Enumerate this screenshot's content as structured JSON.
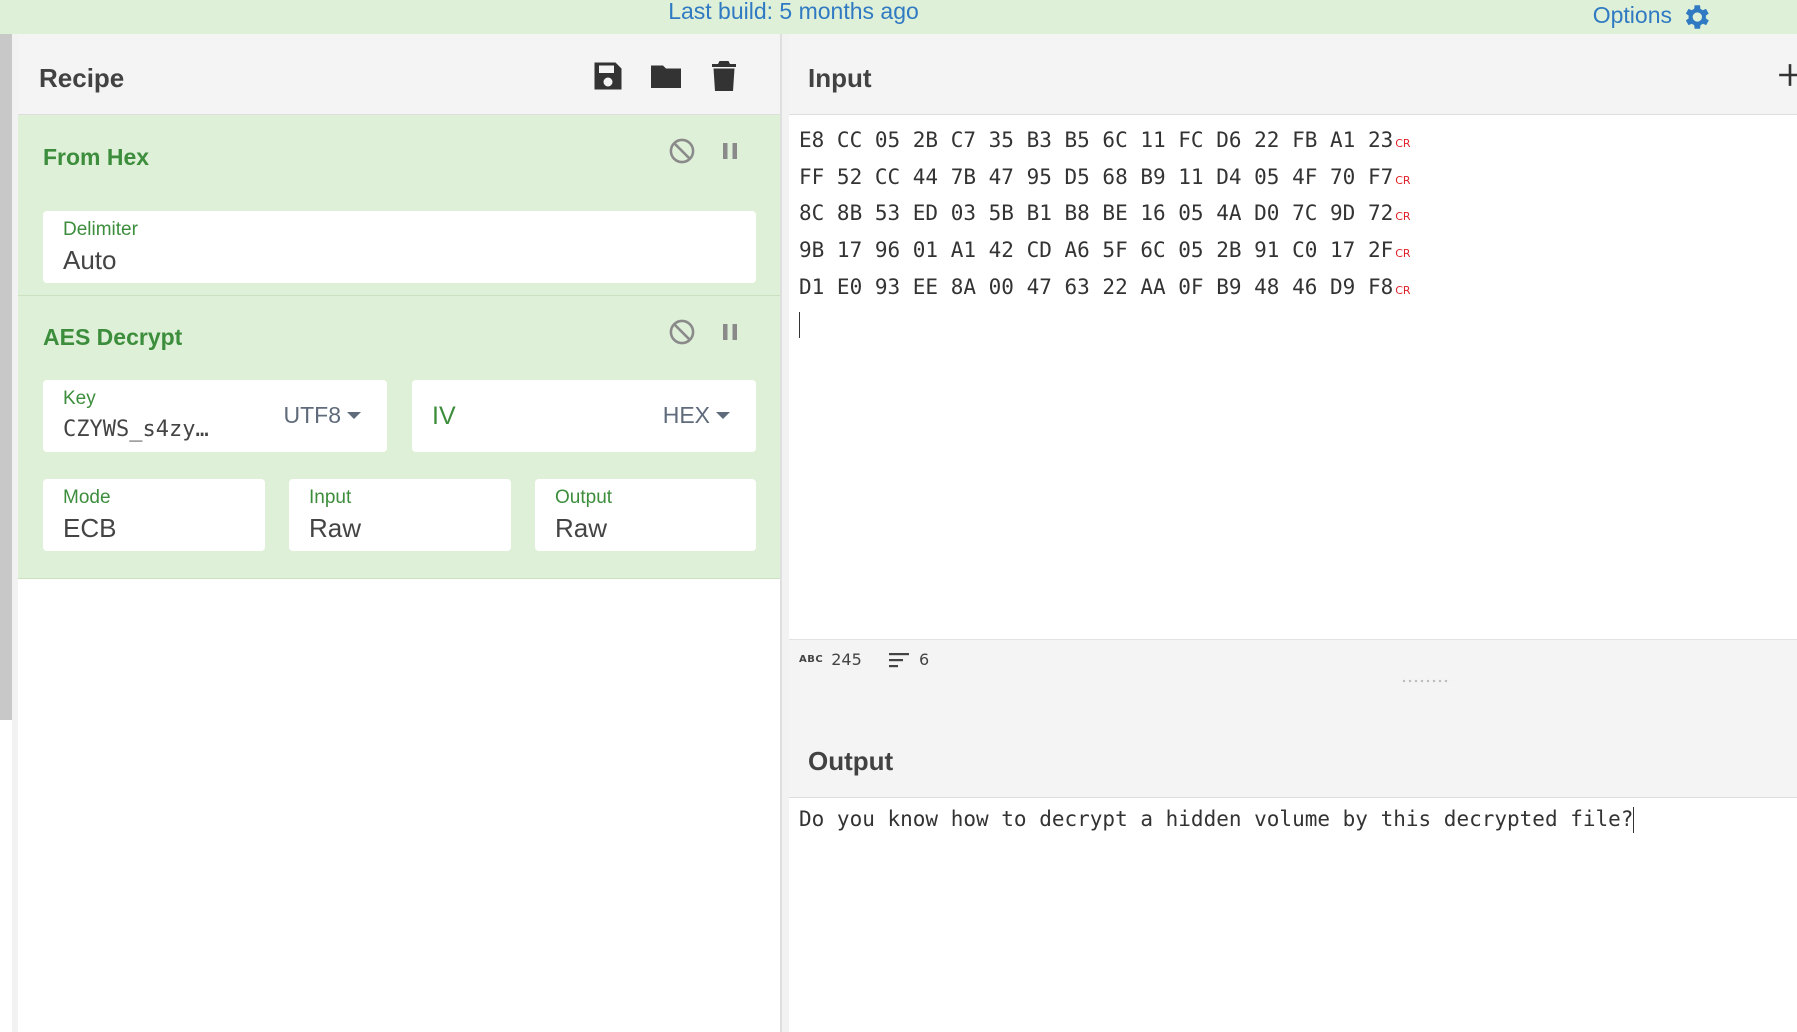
{
  "banner": {
    "text": "Last build: 5 months ago",
    "options_label": "Options"
  },
  "recipe": {
    "title": "Recipe",
    "operations": [
      {
        "name": "From Hex",
        "fields": [
          {
            "label": "Delimiter",
            "value": "Auto"
          }
        ]
      },
      {
        "name": "AES Decrypt",
        "key": {
          "label": "Key",
          "value": "CZYWS_s4zy…",
          "encoding": "UTF8"
        },
        "iv": {
          "placeholder": "IV",
          "encoding": "HEX"
        },
        "mode": {
          "label": "Mode",
          "value": "ECB"
        },
        "input": {
          "label": "Input",
          "value": "Raw"
        },
        "output": {
          "label": "Output",
          "value": "Raw"
        }
      }
    ]
  },
  "input": {
    "title": "Input",
    "lines": [
      "E8 CC 05 2B C7 35 B3 B5 6C 11 FC D6 22 FB A1 23",
      "FF 52 CC 44 7B 47 95 D5 68 B9 11 D4 05 4F 70 F7",
      "8C 8B 53 ED 03 5B B1 B8 BE 16 05 4A D0 7C 9D 72",
      "9B 17 96 01 A1 42 CD A6 5F 6C 05 2B 91 C0 17 2F",
      "D1 E0 93 EE 8A 00 47 63 22 AA 0F B9 48 46 D9 F8"
    ],
    "line_end_marker": "CR",
    "status": {
      "abc_label": "ABC",
      "char_count": "245",
      "line_count": "6"
    }
  },
  "output": {
    "title": "Output",
    "text": "Do you know how to decrypt a hidden volume by this decrypted file?"
  },
  "colors": {
    "banner_bg": "#dff0d8",
    "link_blue": "#2f7ac2",
    "operation_bg": "#dff0d8",
    "operation_green": "#3c8d3c",
    "cr_red": "#e0202a"
  }
}
